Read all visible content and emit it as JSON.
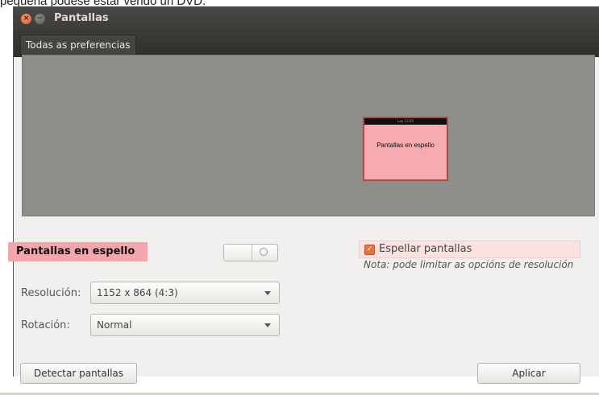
{
  "caption": "pequena podese estar vendo un DVD.",
  "window": {
    "title": "Pantallas",
    "close_glyph": "×",
    "minimize_glyph": "−"
  },
  "toolbar": {
    "all_settings_label": "Todas as preferencias"
  },
  "display": {
    "monitor_top_text": "Lap 13:00",
    "monitor_label": "Pantallas en espello"
  },
  "panel": {
    "header": "Pantallas en espello",
    "switch_off_glyph": "○",
    "resolution_label": "Resolución:",
    "resolution_value": "1152 x 864 (4:3)",
    "rotation_label": "Rotación:",
    "rotation_value": "Normal"
  },
  "mirror": {
    "checked": true,
    "check_glyph": "✓",
    "label": "Espellar pantallas",
    "note": "Nota: pode limitar as opcións de resolución"
  },
  "buttons": {
    "detect": "Detectar pantallas",
    "apply": "Aplicar"
  },
  "colors": {
    "titlebar": "#3c3b37",
    "monitor_fill": "#f7aab0",
    "header_highlight": "#f3a7ac",
    "checkbox_accent": "#e2763c"
  },
  "icons": [
    "close-icon",
    "minimize-icon",
    "checkbox-check-icon",
    "dropdown-arrow-icon"
  ]
}
